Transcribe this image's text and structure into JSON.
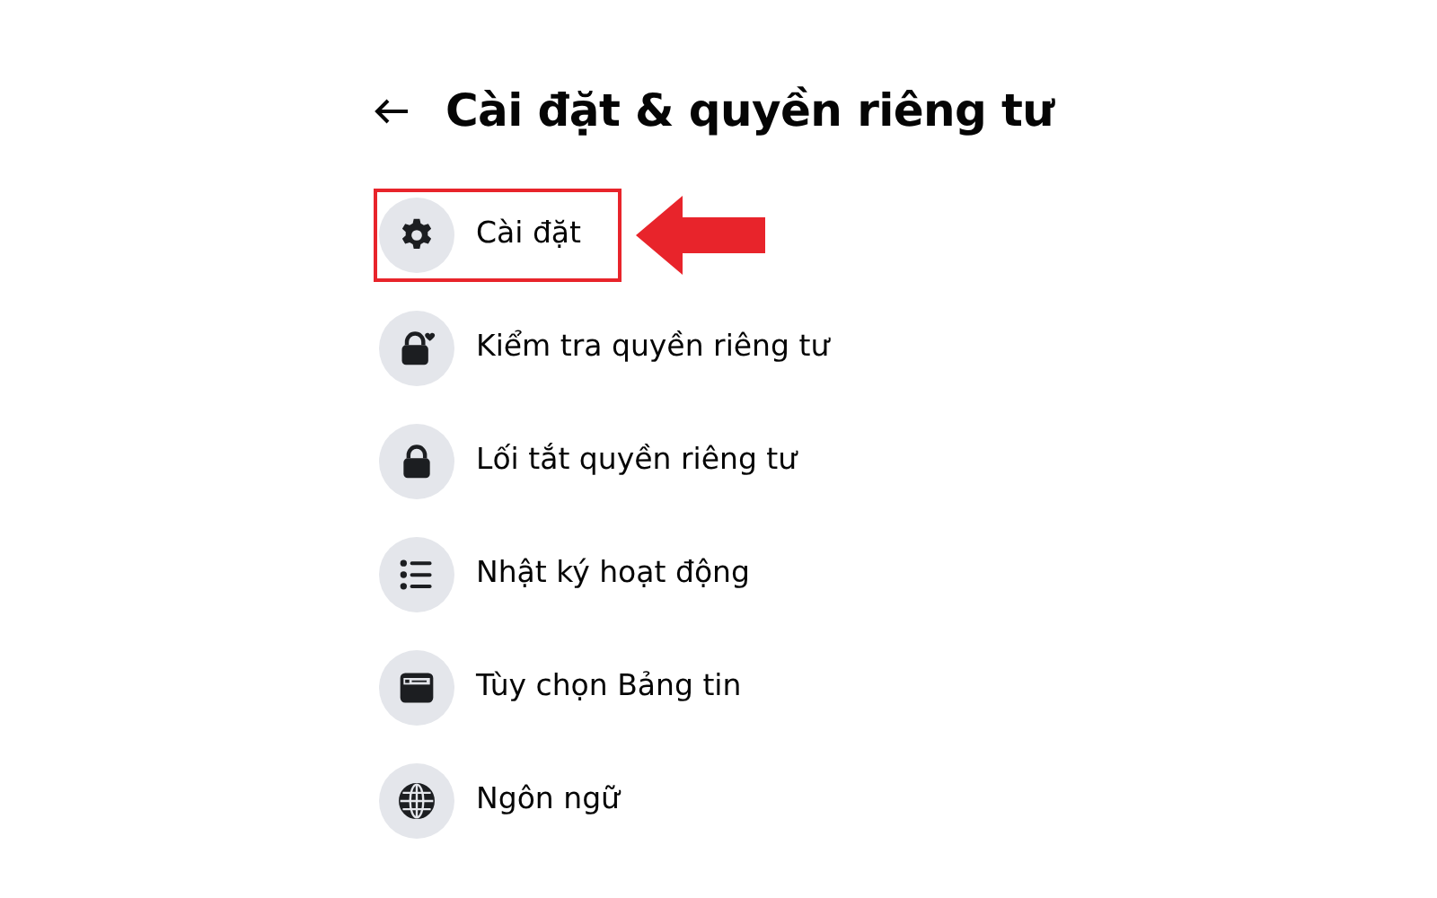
{
  "header": {
    "title": "Cài đặt & quyền riêng tư"
  },
  "menu": [
    {
      "label": "Cài đặt",
      "kind": "gear",
      "highlighted": true
    },
    {
      "label": "Kiểm tra quyền riêng tư",
      "kind": "lock-heart",
      "highlighted": false
    },
    {
      "label": "Lối tắt quyền riêng tư",
      "kind": "lock",
      "highlighted": false
    },
    {
      "label": "Nhật ký hoạt động",
      "kind": "list",
      "highlighted": false
    },
    {
      "label": "Tùy chọn Bảng tin",
      "kind": "feed",
      "highlighted": false
    },
    {
      "label": "Ngôn ngữ",
      "kind": "globe",
      "highlighted": false
    }
  ]
}
